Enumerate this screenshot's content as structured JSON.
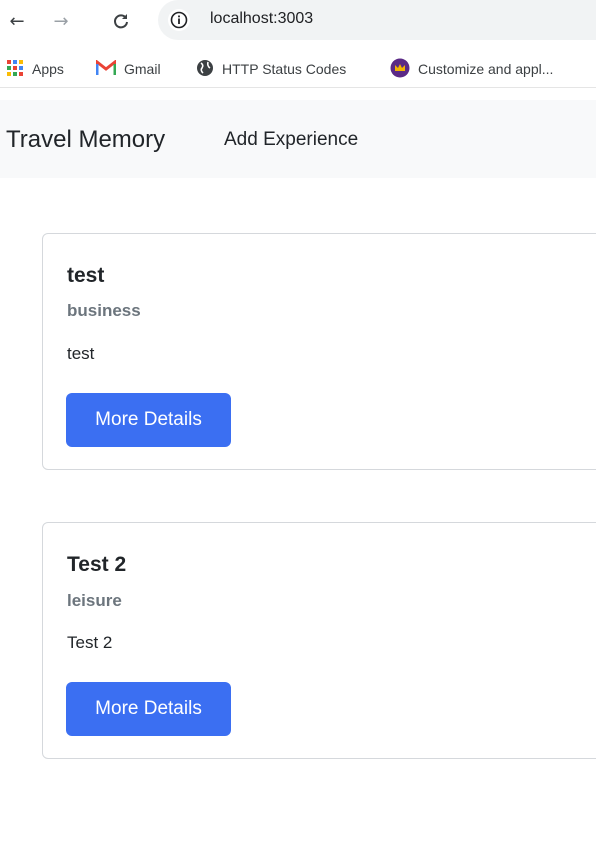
{
  "browser": {
    "url": "localhost:3003",
    "bookmarks": [
      {
        "label": "Apps",
        "icon": "apps-grid-icon"
      },
      {
        "label": "Gmail",
        "icon": "gmail-icon"
      },
      {
        "label": "HTTP Status Codes",
        "icon": "globe-icon"
      },
      {
        "label": "Customize and appl...",
        "icon": "crown-icon"
      }
    ]
  },
  "navbar": {
    "brand": "Travel Memory",
    "link": "Add Experience"
  },
  "cards": [
    {
      "title": "test",
      "subtitle": "business",
      "text": "test",
      "button": "More Details"
    },
    {
      "title": "Test 2",
      "subtitle": "leisure",
      "text": "Test 2",
      "button": "More Details"
    }
  ],
  "colors": {
    "primary": "#3b6ff2",
    "navbar_bg": "#f8f9fa",
    "subtitle": "#6c757d"
  }
}
